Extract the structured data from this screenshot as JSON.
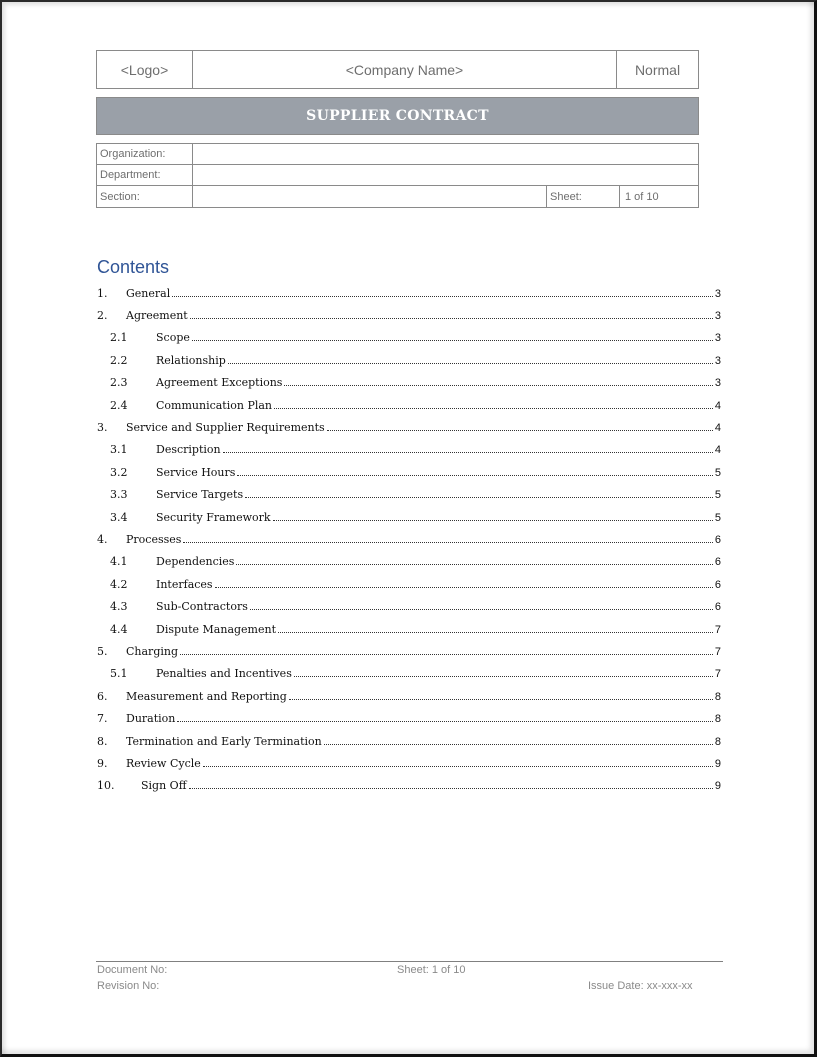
{
  "header": {
    "logo": "<Logo>",
    "company_name": "<Company Name>",
    "status": "Normal"
  },
  "title": "SUPPLIER CONTRACT",
  "info": {
    "organization_label": "Organization:",
    "organization_value": "",
    "department_label": "Department:",
    "department_value": "",
    "section_label": "Section:",
    "section_value": "",
    "sheet_label": "Sheet:",
    "sheet_value": "1 of 10"
  },
  "contents": {
    "heading": "Contents",
    "entries": [
      {
        "num": "1.",
        "title": "General",
        "page": "3",
        "level": 1
      },
      {
        "num": "2.",
        "title": "Agreement",
        "page": "3",
        "level": 1
      },
      {
        "num": "2.1",
        "title": "Scope",
        "page": "3",
        "level": 2
      },
      {
        "num": "2.2",
        "title": "Relationship",
        "page": "3",
        "level": 2
      },
      {
        "num": "2.3",
        "title": "Agreement Exceptions",
        "page": "3",
        "level": 2
      },
      {
        "num": "2.4",
        "title": "Communication Plan",
        "page": "4",
        "level": 2
      },
      {
        "num": "3.",
        "title": "Service and Supplier Requirements",
        "page": "4",
        "level": 1
      },
      {
        "num": "3.1",
        "title": "Description",
        "page": "4",
        "level": 2
      },
      {
        "num": "3.2",
        "title": "Service Hours",
        "page": "5",
        "level": 2
      },
      {
        "num": "3.3",
        "title": "Service Targets",
        "page": "5",
        "level": 2
      },
      {
        "num": "3.4",
        "title": "Security Framework",
        "page": "5",
        "level": 2
      },
      {
        "num": "4.",
        "title": "Processes",
        "page": "6",
        "level": 1
      },
      {
        "num": "4.1",
        "title": "Dependencies",
        "page": "6",
        "level": 2
      },
      {
        "num": "4.2",
        "title": "Interfaces",
        "page": "6",
        "level": 2
      },
      {
        "num": "4.3",
        "title": "Sub-Contractors",
        "page": "6",
        "level": 2
      },
      {
        "num": "4.4",
        "title": "Dispute Management",
        "page": "7",
        "level": 2
      },
      {
        "num": "5.",
        "title": "Charging",
        "page": "7",
        "level": 1
      },
      {
        "num": "5.1",
        "title": "Penalties and Incentives",
        "page": "7",
        "level": 2
      },
      {
        "num": "6.",
        "title": "Measurement and Reporting",
        "page": "8",
        "level": 1
      },
      {
        "num": "7.",
        "title": "Duration",
        "page": "8",
        "level": 1
      },
      {
        "num": "8.",
        "title": "Termination and Early Termination",
        "page": "8",
        "level": 1
      },
      {
        "num": "9.",
        "title": "Review Cycle",
        "page": "9",
        "level": 1
      },
      {
        "num": "10.",
        "title": "Sign Off",
        "page": "9",
        "level": 1,
        "wide": true
      }
    ]
  },
  "footer": {
    "document_no": "Document No:",
    "revision_no": "Revision No:",
    "sheet": "Sheet: 1 of 10",
    "issue_date": "Issue Date: xx-xxx-xx"
  },
  "colors": {
    "title_bar": "#9aa0a8",
    "contents_heading": "#2f5496",
    "label_text": "#6e6e6e"
  }
}
